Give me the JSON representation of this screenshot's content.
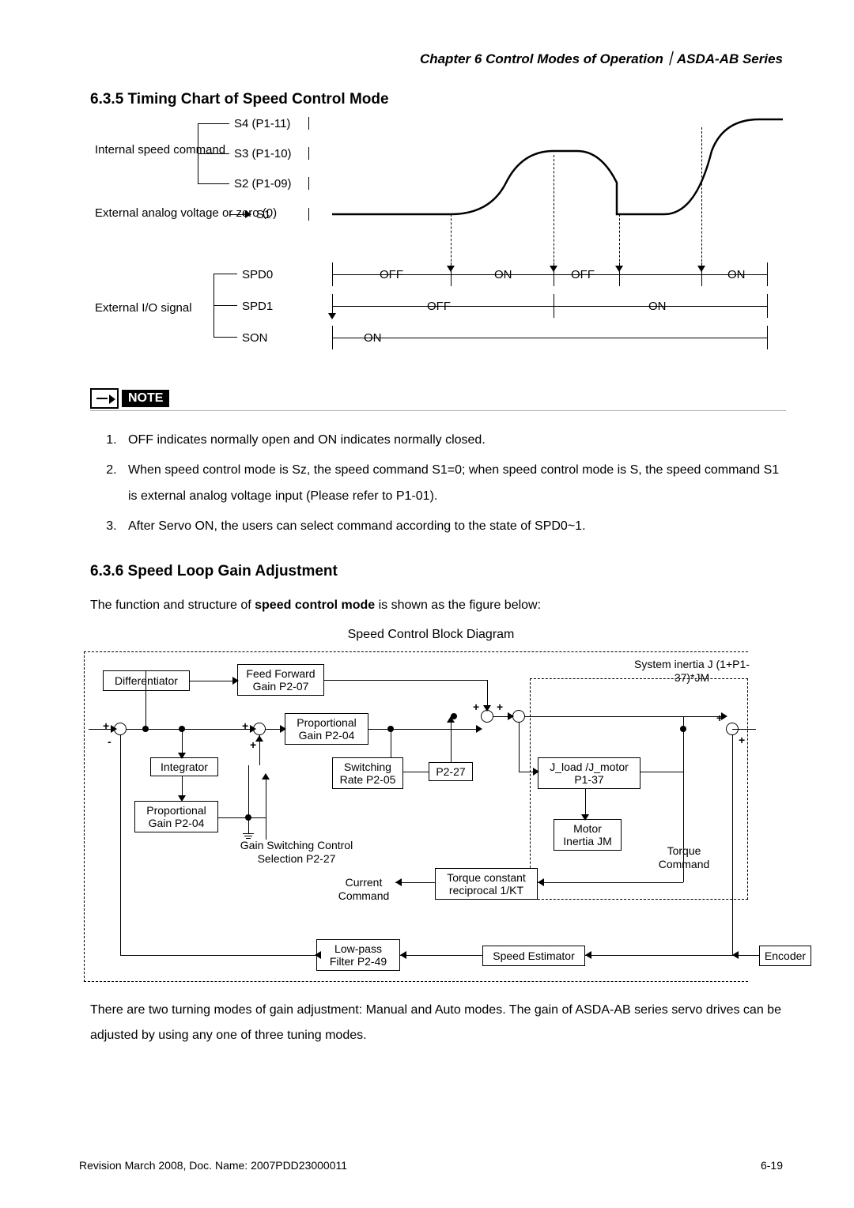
{
  "header": "Chapter 6  Control Modes of Operation｜ASDA-AB Series",
  "section635": "6.3.5  Timing Chart of Speed Control Mode",
  "timing": {
    "internal_speed_cmd": "Internal speed command",
    "s4": "S4 (P1-11)",
    "s3": "S3 (P1-10)",
    "s2": "S2 (P1-09)",
    "external_analog": "External analog voltage or zero (0)",
    "s1": "S1",
    "spd0": "SPD0",
    "spd1": "SPD1",
    "son": "SON",
    "external_io": "External I/O signal",
    "off": "OFF",
    "on": "ON"
  },
  "note_label": "NOTE",
  "notes": [
    "OFF indicates normally open and ON indicates normally closed.",
    "When speed control mode is Sz, the speed command S1=0; when speed control mode is S, the speed command S1 is external analog voltage input (Please refer to P1-01).",
    "After Servo ON, the users can select command according to the state of SPD0~1."
  ],
  "section636": "6.3.6  Speed Loop Gain Adjustment",
  "intro636": "The function and structure of ",
  "intro636_bold": "speed control mode",
  "intro636_tail": " is shown as the figure below:",
  "block_title": "Speed Control Block Diagram",
  "blocks": {
    "differentiator": "Differentiator",
    "ff_gain": "Feed Forward Gain P2-07",
    "prop_gain": "Proportional Gain P2-04",
    "integrator": "Integrator",
    "switching_rate": "Switching Rate P2-05",
    "p2_27": "P2-27",
    "prop_gain2": "Proportional Gain P2-04",
    "gain_switch": "Gain Switching Control Selection P2-27",
    "current_cmd": "Current Command",
    "torque_const": "Torque constant reciprocal 1/KT",
    "torque_cmd": "Torque Command",
    "j_load": "J_load /J_motor P1-37",
    "motor_inertia": "Motor Inertia JM",
    "system_inertia": "System inertia J (1+P1-37)*JM",
    "lowpass": "Low-pass Filter P2-49",
    "speed_est": "Speed Estimator",
    "encoder": "Encoder"
  },
  "para_bottom": "There are two turning modes of gain adjustment: Manual and Auto modes. The gain of ASDA-AB series servo drives can be adjusted by using any one of three tuning modes.",
  "footer_left": "Revision March 2008, Doc. Name: 2007PDD23000011",
  "footer_right": "6-19"
}
